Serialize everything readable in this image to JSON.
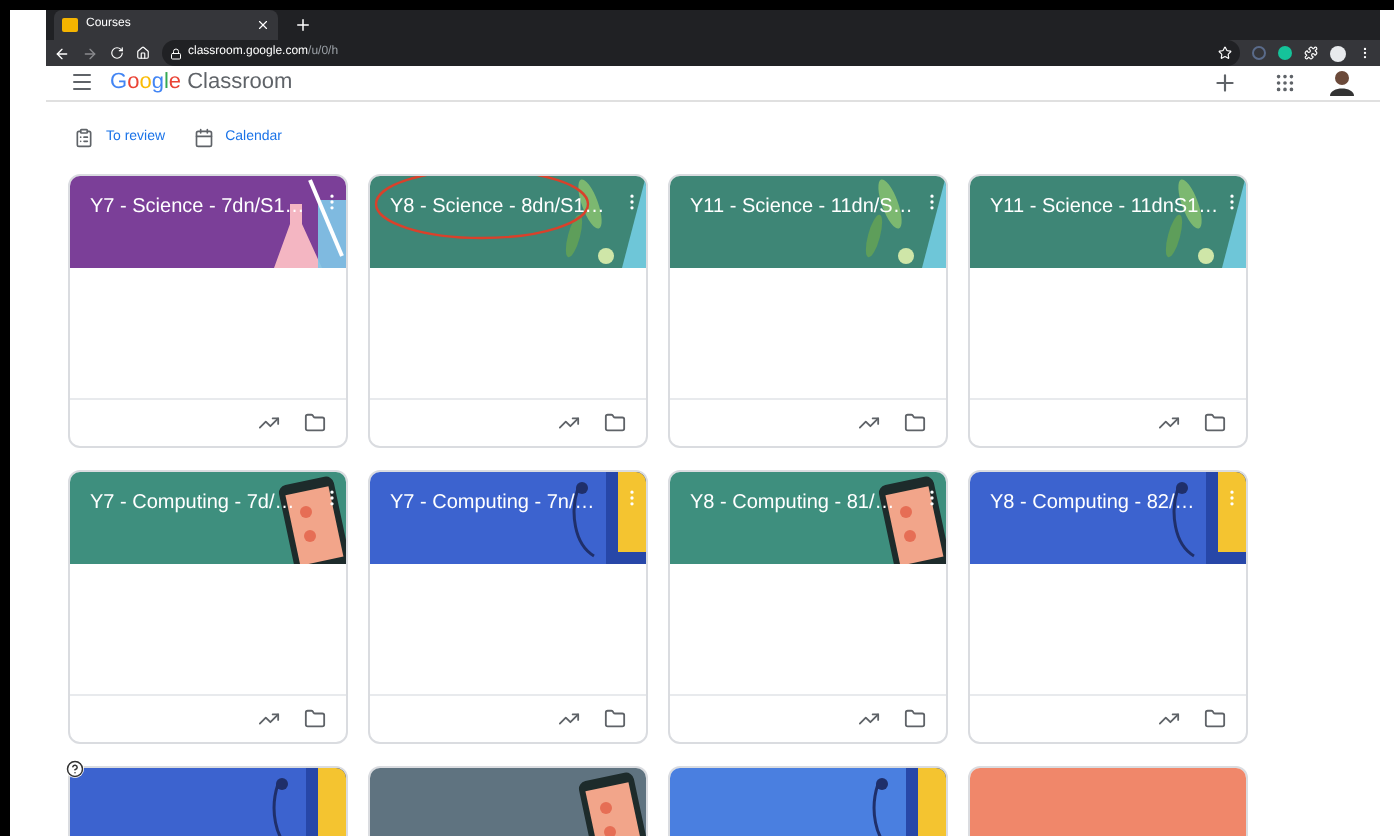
{
  "browser": {
    "tab_title": "Courses",
    "url_host": "classroom.google.com",
    "url_path": "/u/0/h"
  },
  "app_bar": {
    "logo_word": "Google",
    "product": "Classroom"
  },
  "nav_links": [
    {
      "label": "To review",
      "kind": "review"
    },
    {
      "label": "Calendar",
      "kind": "calendar"
    }
  ],
  "courses": [
    {
      "title": "Y7 - Science - 7dn/S1…",
      "color": "#7b3f98",
      "kind": "flask",
      "annotated": false
    },
    {
      "title": "Y8 - Science - 8dn/S1…",
      "color": "#3e8676",
      "kind": "leaves",
      "annotated": true
    },
    {
      "title": "Y11 - Science - 11dn/S…",
      "color": "#3e8676",
      "kind": "leaves",
      "annotated": false
    },
    {
      "title": "Y11 - Science - 11dnS1…",
      "color": "#3e8676",
      "kind": "leaves",
      "annotated": false
    },
    {
      "title": "Y7 - Computing - 7d/…",
      "color": "#3e8f7e",
      "kind": "phone",
      "annotated": false
    },
    {
      "title": "Y7 - Computing - 7n/…",
      "color": "#3c63cf",
      "kind": "headphones",
      "annotated": false
    },
    {
      "title": "Y8 - Computing - 81/…",
      "color": "#3e8f7e",
      "kind": "phone",
      "annotated": false
    },
    {
      "title": "Y8 - Computing - 82/…",
      "color": "#3c63cf",
      "kind": "headphones",
      "annotated": false
    },
    {
      "color": "#3c63cf",
      "kind": "headphones",
      "annotated": false
    },
    {
      "color": "#5f7380",
      "kind": "phone",
      "annotated": false
    },
    {
      "color": "#4a7fe0",
      "kind": "headphones",
      "annotated": false
    },
    {
      "color": "#f0876a",
      "kind": "plain",
      "annotated": false
    }
  ]
}
